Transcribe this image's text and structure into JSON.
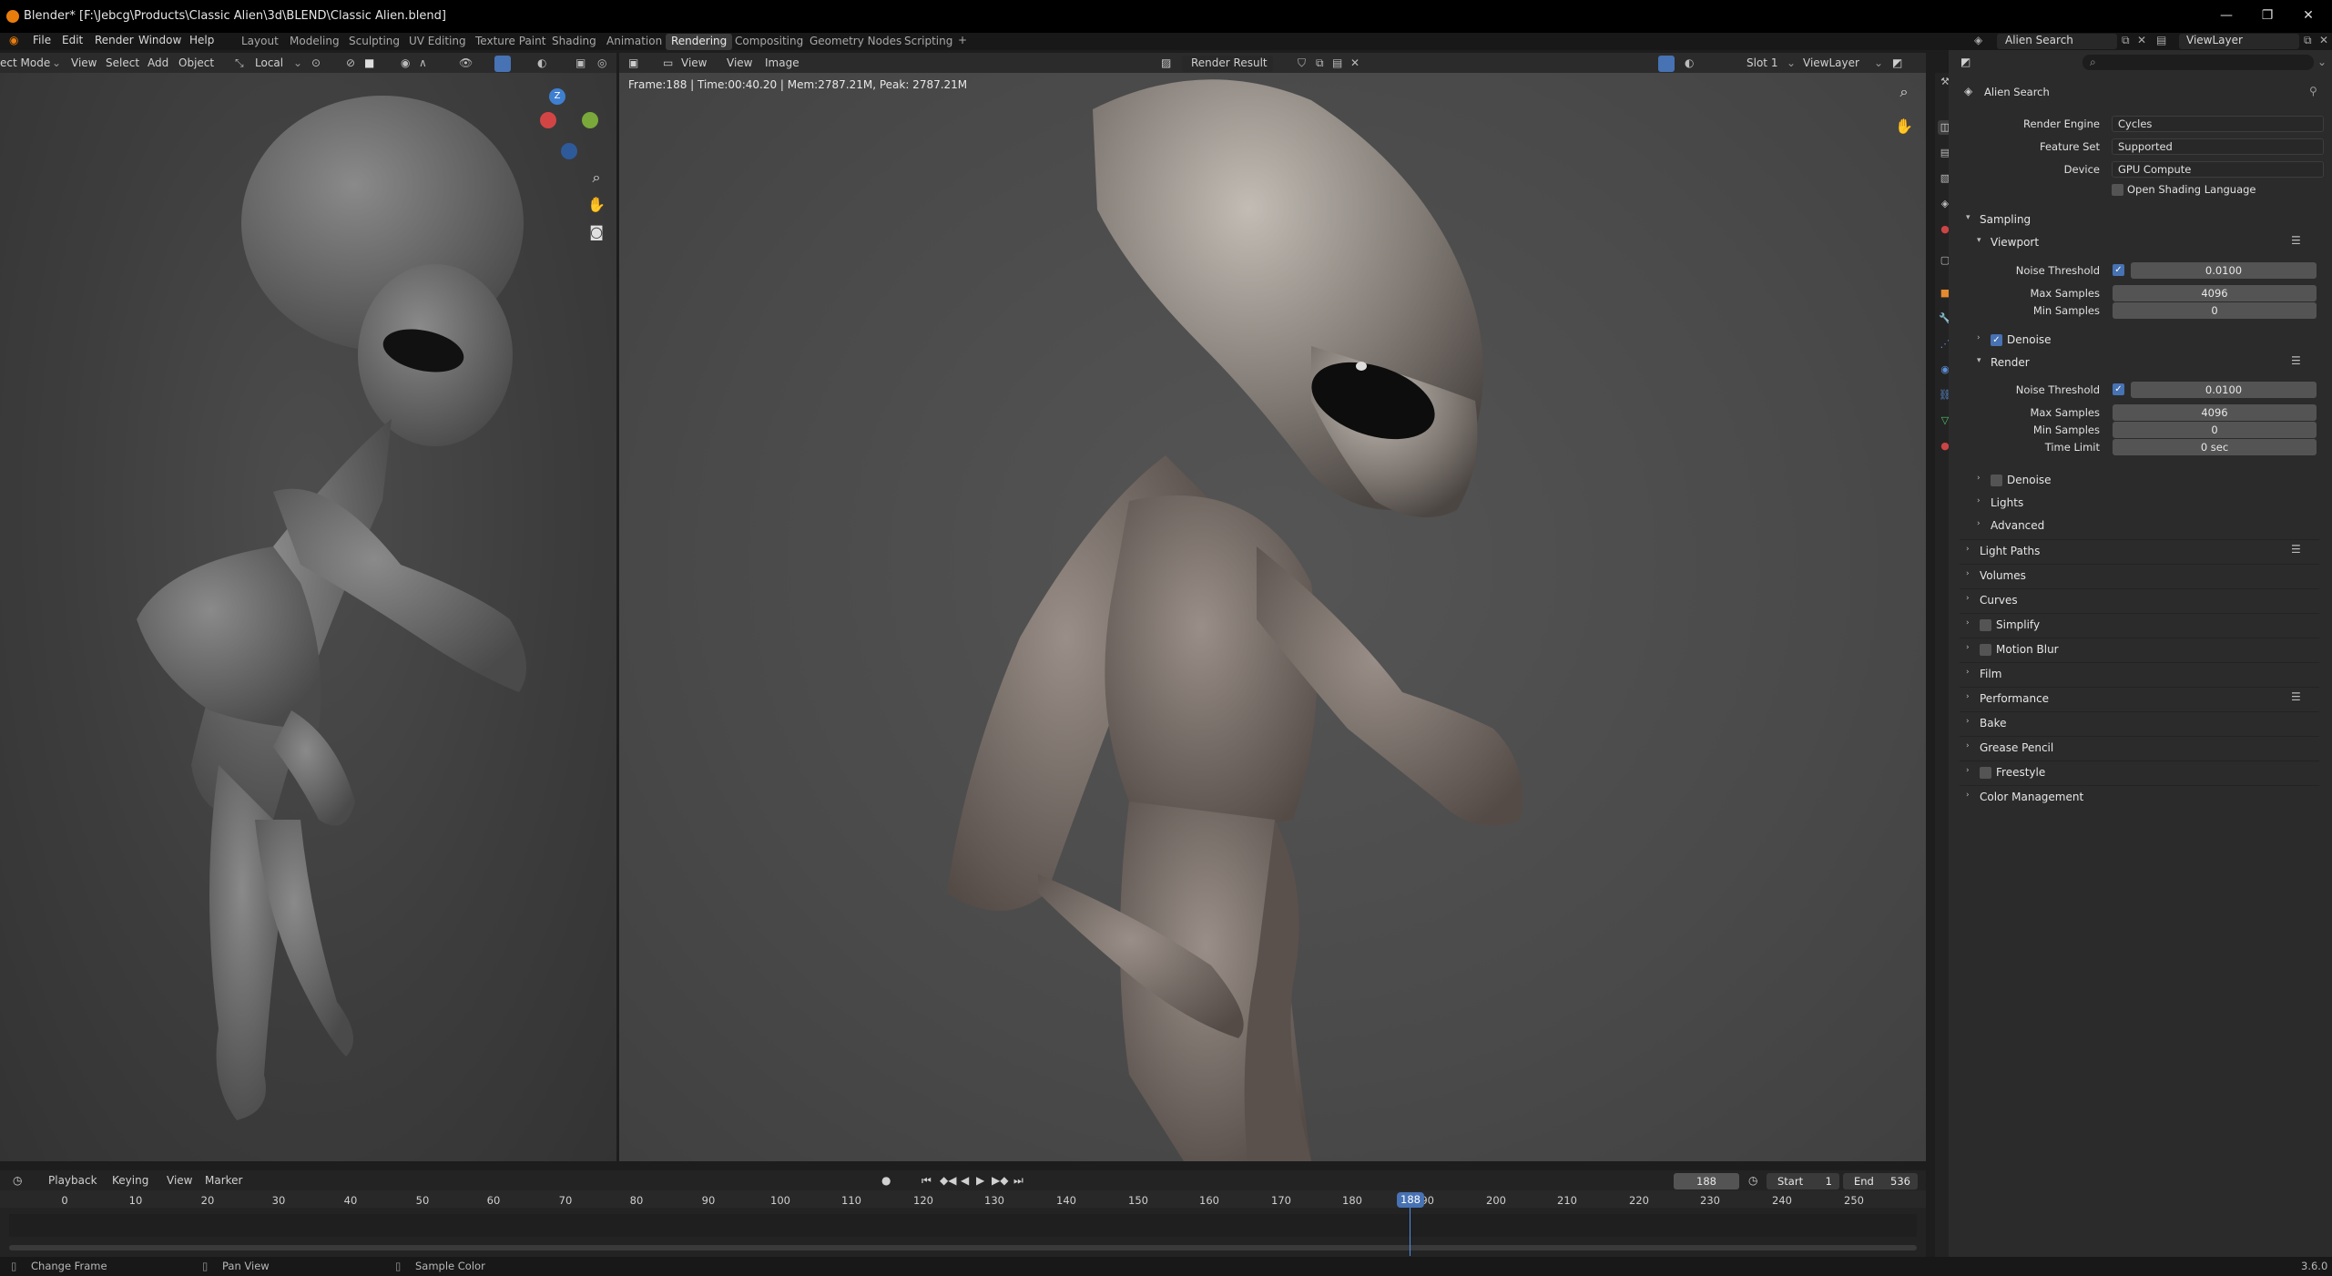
{
  "window": {
    "title": "Blender* [F:\\Jebcg\\Products\\Classic Alien\\3d\\BLEND\\Classic Alien.blend]"
  },
  "menus": [
    "File",
    "Edit",
    "Render",
    "Window",
    "Help"
  ],
  "workspaces": [
    "Layout",
    "Modeling",
    "Sculpting",
    "UV Editing",
    "Texture Paint",
    "Shading",
    "Animation",
    "Rendering",
    "Compositing",
    "Geometry Nodes",
    "Scripting"
  ],
  "active_workspace": "Rendering",
  "scene": {
    "name": "Alien Search",
    "view_layer": "ViewLayer"
  },
  "left_viewport": {
    "mode": "ect Mode",
    "view": "View",
    "select": "Select",
    "add": "Add",
    "object": "Object",
    "transform": "Local"
  },
  "render_view": {
    "view_menu": "View",
    "view_menu2": "View",
    "image_menu": "Image",
    "image_name": "Render Result",
    "slot": "Slot 1",
    "layer": "ViewLayer",
    "info": "Frame:188 | Time:00:40.20 | Mem:2787.21M, Peak: 2787.21M"
  },
  "gizmo": {
    "z": "Z"
  },
  "properties": {
    "scene_name": "Alien Search",
    "render_engine_label": "Render Engine",
    "render_engine": "Cycles",
    "feature_set_label": "Feature Set",
    "feature_set": "Supported",
    "device_label": "Device",
    "device": "GPU Compute",
    "osl": "Open Shading Language",
    "sampling": "Sampling",
    "viewport": "Viewport",
    "noise_threshold_label": "Noise Threshold",
    "vp_noise": "0.0100",
    "max_samples_label": "Max Samples",
    "vp_max": "4096",
    "min_samples_label": "Min Samples",
    "vp_min": "0",
    "denoise": "Denoise",
    "render": "Render",
    "r_noise": "0.0100",
    "r_max": "4096",
    "r_min": "0",
    "time_limit_label": "Time Limit",
    "r_time": "0 sec",
    "denoise2": "Denoise",
    "lights": "Lights",
    "advanced": "Advanced",
    "sections": [
      "Light Paths",
      "Volumes",
      "Curves",
      "Simplify",
      "Motion Blur",
      "Film",
      "Performance",
      "Bake",
      "Grease Pencil",
      "Freestyle",
      "Color Management"
    ]
  },
  "timeline": {
    "playback": "Playback",
    "keying": "Keying",
    "view": "View",
    "marker": "Marker",
    "current_frame": "188",
    "start_label": "Start",
    "start": "1",
    "end_label": "End",
    "end": "536",
    "ticks": [
      "0",
      "10",
      "20",
      "30",
      "40",
      "50",
      "60",
      "70",
      "80",
      "90",
      "100",
      "110",
      "120",
      "130",
      "140",
      "150",
      "160",
      "170",
      "180",
      "190",
      "200",
      "210",
      "220",
      "230",
      "240",
      "250"
    ],
    "playhead": "188"
  },
  "status": {
    "left": "Change Frame",
    "mid": "Pan View",
    "right": "Sample Color",
    "version": "3.6.0"
  },
  "colors": {
    "accent": "#4772b3",
    "x_axis": "#d34545",
    "y_axis": "#7aa83a",
    "z_axis": "#3f7fd1"
  }
}
